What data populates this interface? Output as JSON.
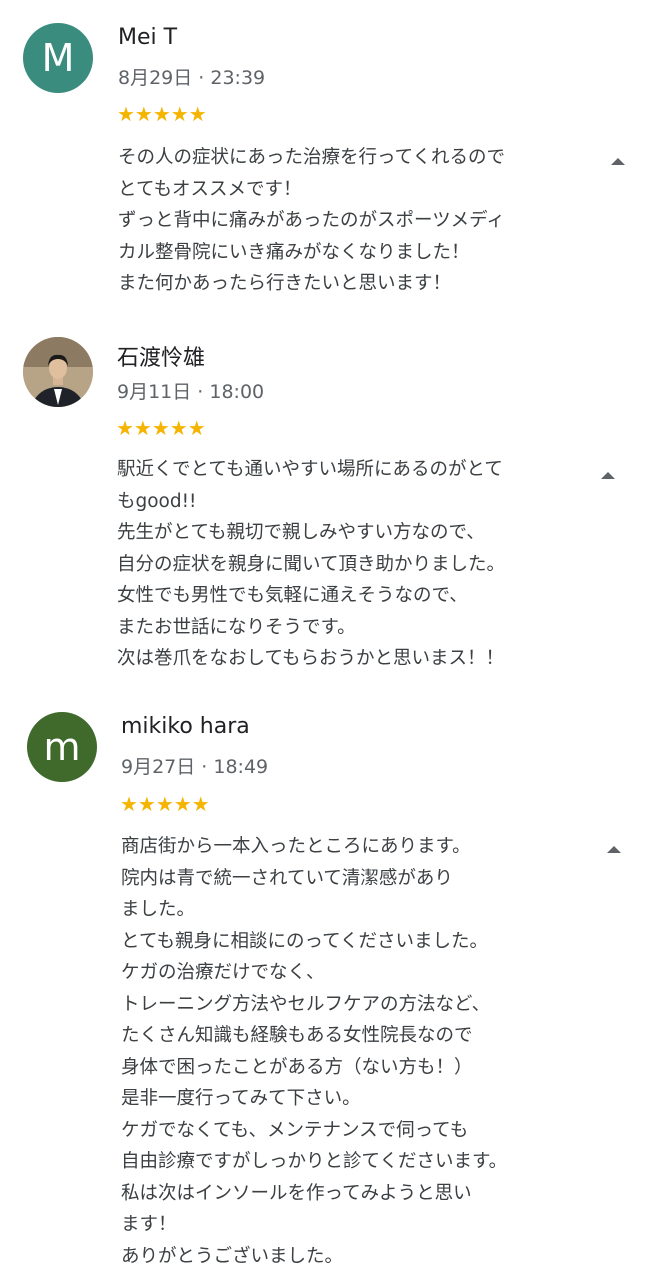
{
  "reviews": [
    {
      "avatar_letter": "M",
      "avatar_color": "#3a8c7e",
      "name": "Mei T",
      "date": "8月29日 · 23:39",
      "stars": "★★★★★",
      "lines": [
        "その人の症状にあった治療を行ってくれるので",
        "とてもオススメです！",
        "ずっと背中に痛みがあったのがスポーツメディ",
        "カル整骨院にいき痛みがなくなりました！",
        "また何かあったら行きたいと思います！"
      ]
    },
    {
      "avatar_letter": "",
      "avatar_color": "#6b5a48",
      "name": "石渡怜雄",
      "date": "9月11日 · 18:00",
      "stars": "★★★★★",
      "lines": [
        "駅近くでとても通いやすい場所にあるのがとて",
        "もgood!!",
        "先生がとても親切で親しみやすい方なので、",
        "自分の症状を親身に聞いて頂き助かりました。",
        "女性でも男性でも気軽に通えそうなので、",
        "またお世話になりそうです。",
        "次は巻爪をなおしてもらおうかと思いまス！！"
      ]
    },
    {
      "avatar_letter": "m",
      "avatar_color": "#3f6a2c",
      "name": "mikiko hara",
      "date": "9月27日 · 18:49",
      "stars": "★★★★★",
      "lines": [
        "商店街から一本入ったところにあります。",
        "院内は青で統一されていて清潔感があり",
        "ました。",
        "とても親身に相談にのってくださいました。",
        "ケガの治療だけでなく、",
        "トレーニング方法やセルフケアの方法など、",
        "たくさん知識も経験もある女性院長なので",
        "身体で困ったことがある方（ない方も！）",
        "是非一度行ってみて下さい。",
        "ケガでなくても、メンテナンスで伺っても",
        "自由診療ですがしっかりと診てくださいます。",
        "私は次はインソールを作ってみようと思い",
        "ます！",
        "ありがとうございました。"
      ]
    }
  ]
}
